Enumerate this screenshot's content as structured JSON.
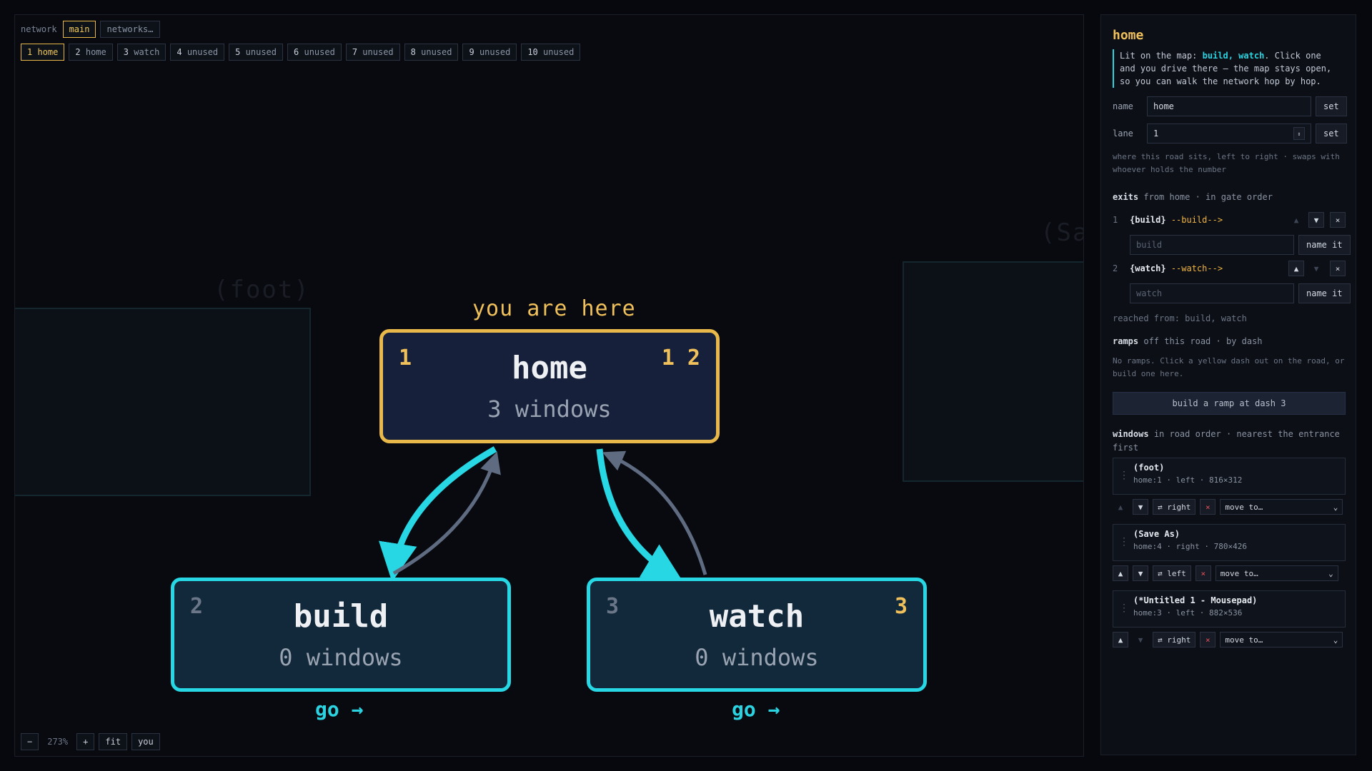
{
  "network": {
    "label": "network",
    "current": "main",
    "networks_button": "networks…",
    "lanes": [
      {
        "num": "1",
        "name": "home",
        "active": true
      },
      {
        "num": "2",
        "name": "home"
      },
      {
        "num": "3",
        "name": "watch"
      },
      {
        "num": "4",
        "name": "unused"
      },
      {
        "num": "5",
        "name": "unused"
      },
      {
        "num": "6",
        "name": "unused"
      },
      {
        "num": "7",
        "name": "unused"
      },
      {
        "num": "8",
        "name": "unused"
      },
      {
        "num": "9",
        "name": "unused"
      },
      {
        "num": "10",
        "name": "unused"
      }
    ]
  },
  "map": {
    "here_label": "you are here",
    "background_labels": [
      "(foot)",
      "(Sav"
    ],
    "nodes": {
      "home": {
        "lane": "1",
        "name": "home",
        "windows": "3 windows",
        "gates": "1 2"
      },
      "build": {
        "lane": "2",
        "name": "build",
        "windows": "0 windows"
      },
      "watch": {
        "lane": "3",
        "name": "watch",
        "windows": "0 windows",
        "gates": "3"
      }
    },
    "go_label": "go →",
    "zoom": {
      "minus": "−",
      "value": "273%",
      "plus": "+",
      "fit": "fit",
      "you": "you"
    },
    "colors": {
      "current": "#e8b84a",
      "exit": "#27d8e4",
      "return_arrow": "#5f6b80"
    }
  },
  "panel": {
    "title": "home",
    "note_prefix": "Lit on the map: ",
    "note_links": "build, watch",
    "note_suffix": ". Click one and you drive there — the map stays open, so you can walk the network hop by hop.",
    "name_label": "name",
    "name_value": "home",
    "lane_label": "lane",
    "lane_value": "1",
    "set_label": "set",
    "lane_hint": "where this road sits, left to right · swaps with whoever holds the number",
    "exits_heading": "exits",
    "exits_sub": "from home · in gate order",
    "exits": [
      {
        "num": "1",
        "code": "{build}",
        "arrow": "--build-->",
        "placeholder": "build"
      },
      {
        "num": "2",
        "code": "{watch}",
        "arrow": "--watch-->",
        "placeholder": "watch"
      }
    ],
    "name_it": "name it",
    "reached_from": "reached from: build, watch",
    "ramps_heading": "ramps",
    "ramps_sub": "off this road · by dash",
    "ramps_note": "No ramps. Click a yellow dash out on the road, or build one here.",
    "ramp_button": "build a ramp at dash 3",
    "windows_heading": "windows",
    "windows_sub": "in road order · nearest the entrance first",
    "windows": [
      {
        "title": "(foot)",
        "meta": "home:1 · left · 816×312",
        "swap": "⇄ right"
      },
      {
        "title": "(Save As)",
        "meta": "home:4 · right · 780×426",
        "swap": "⇄ left"
      },
      {
        "title": "(*Untitled 1 - Mousepad)",
        "meta": "home:3 · left · 882×536",
        "swap": "⇄ right"
      }
    ],
    "move_to": "move to…"
  }
}
